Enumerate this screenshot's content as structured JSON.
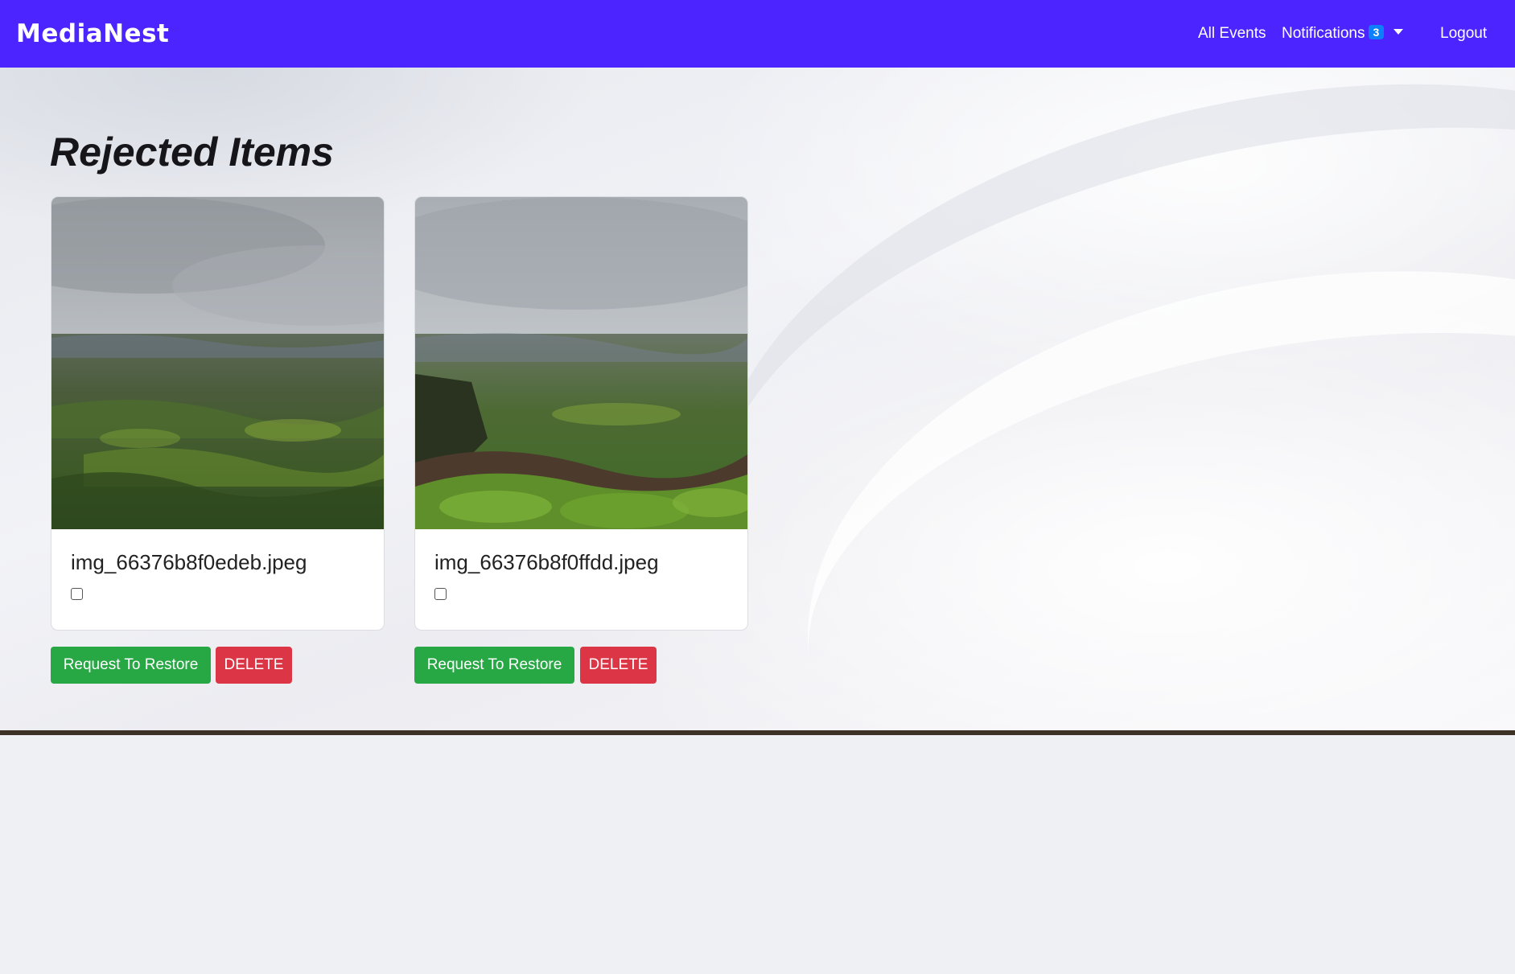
{
  "navbar": {
    "brand": "MediaNest",
    "all_events": "All Events",
    "notifications": "Notifications",
    "notification_count": "3",
    "logout": "Logout",
    "color": "#4b24ff"
  },
  "page": {
    "title": "Rejected Items"
  },
  "cards": [
    {
      "filename": "img_66376b8f0edeb.jpeg",
      "checked": false,
      "restore_label": "Request To Restore",
      "delete_label": "DELETE"
    },
    {
      "filename": "img_66376b8f0ffdd.jpeg",
      "checked": false,
      "restore_label": "Request To Restore",
      "delete_label": "DELETE"
    }
  ],
  "colors": {
    "restore": "#28a745",
    "delete": "#dc3545",
    "badge": "#0d7ffb"
  }
}
